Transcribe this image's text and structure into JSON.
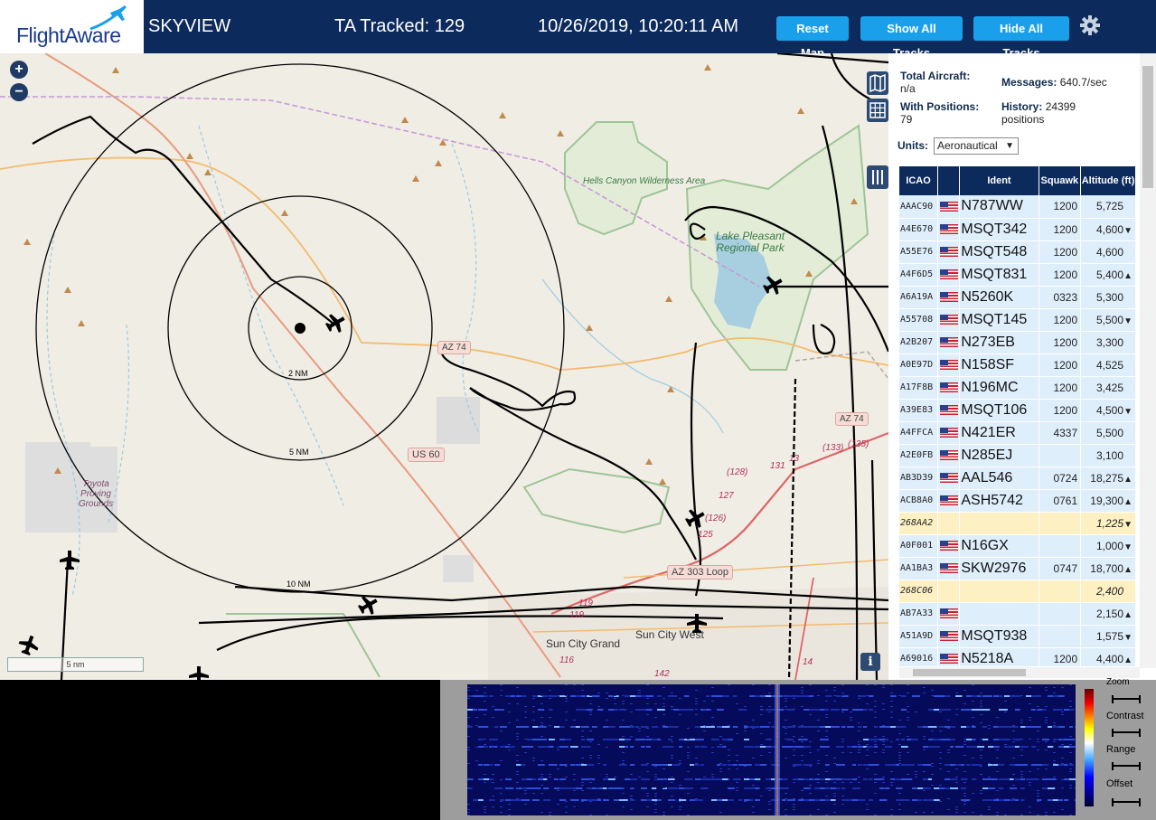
{
  "header": {
    "logo_text": "FlightAware",
    "site_name": "SKYVIEW",
    "tracked": "TA Tracked: 129",
    "clock": "10/26/2019, 10:20:11 AM",
    "buttons": {
      "reset": "Reset Map",
      "show_all": "Show All Tracks",
      "hide_all": "Hide All Tracks"
    },
    "settings_icon": "gear-icon"
  },
  "map": {
    "zoom_in": "+",
    "zoom_out": "−",
    "labels": {
      "hells_canyon": "Hells Canyon Wilderness Area",
      "lake_pleasant": "Lake Pleasant Regional Park",
      "toyota": "Toyota Proving Grounds",
      "sun_city_grand": "Sun City Grand",
      "sun_city_west": "Sun City West"
    },
    "range_rings": [
      "2 NM",
      "5 NM",
      "10 NM"
    ],
    "roads": {
      "az74_a": "AZ 74",
      "az74_b": "AZ 74",
      "us60": "US 60",
      "az303": "AZ 303 Loop",
      "r128": "(128)",
      "r127": "127",
      "r126": "(126)",
      "r125": "125",
      "r131": "131",
      "r13": "13",
      "r133": "(133)",
      "r135": "(135)",
      "r119": "119",
      "r119b": "119",
      "r116": "116",
      "r142": "142",
      "r14": "14"
    },
    "scale": "5 nm",
    "info": "i"
  },
  "panel": {
    "total_aircraft_label": "Total Aircraft:",
    "total_aircraft_value": "n/a",
    "messages_label": "Messages:",
    "messages_value": "640.7/sec",
    "with_positions_label": "With Positions:",
    "with_positions_value": "79",
    "history_label": "History:",
    "history_value": "24399 positions",
    "units_label": "Units:",
    "units_value": "Aeronautical",
    "columns": [
      "ICAO",
      "",
      "Ident",
      "Squawk",
      "Altitude (ft)"
    ],
    "rows": [
      {
        "icao": "AAAC90",
        "flag": true,
        "ident": "N787WW",
        "squawk": "1200",
        "alt": "5,725",
        "trend": "",
        "yellow": false
      },
      {
        "icao": "A4E670",
        "flag": true,
        "ident": "MSQT342",
        "squawk": "1200",
        "alt": "4,600",
        "trend": "▼",
        "yellow": false
      },
      {
        "icao": "A55E76",
        "flag": true,
        "ident": "MSQT548",
        "squawk": "1200",
        "alt": "4,600",
        "trend": "",
        "yellow": false
      },
      {
        "icao": "A4F6D5",
        "flag": true,
        "ident": "MSQT831",
        "squawk": "1200",
        "alt": "5,400",
        "trend": "▲",
        "yellow": false
      },
      {
        "icao": "A6A19A",
        "flag": true,
        "ident": "N5260K",
        "squawk": "0323",
        "alt": "5,300",
        "trend": "",
        "yellow": false
      },
      {
        "icao": "A55708",
        "flag": true,
        "ident": "MSQT145",
        "squawk": "1200",
        "alt": "5,500",
        "trend": "▼",
        "yellow": false
      },
      {
        "icao": "A2B207",
        "flag": true,
        "ident": "N273EB",
        "squawk": "1200",
        "alt": "3,300",
        "trend": "",
        "yellow": false
      },
      {
        "icao": "A0E97D",
        "flag": true,
        "ident": "N158SF",
        "squawk": "1200",
        "alt": "4,525",
        "trend": "",
        "yellow": false
      },
      {
        "icao": "A17F8B",
        "flag": true,
        "ident": "N196MC",
        "squawk": "1200",
        "alt": "3,425",
        "trend": "",
        "yellow": false
      },
      {
        "icao": "A39E83",
        "flag": true,
        "ident": "MSQT106",
        "squawk": "1200",
        "alt": "4,500",
        "trend": "▼",
        "yellow": false
      },
      {
        "icao": "A4FFCA",
        "flag": true,
        "ident": "N421ER",
        "squawk": "4337",
        "alt": "5,500",
        "trend": "",
        "yellow": false
      },
      {
        "icao": "A2E0FB",
        "flag": true,
        "ident": "N285EJ",
        "squawk": "",
        "alt": "3,100",
        "trend": "",
        "yellow": false
      },
      {
        "icao": "AB3D39",
        "flag": true,
        "ident": "AAL546",
        "squawk": "0724",
        "alt": "18,275",
        "trend": "▲",
        "yellow": false
      },
      {
        "icao": "ACB8A0",
        "flag": true,
        "ident": "ASH5742",
        "squawk": "0761",
        "alt": "19,300",
        "trend": "▲",
        "yellow": false
      },
      {
        "icao": "268AA2",
        "flag": false,
        "ident": "",
        "squawk": "",
        "alt": "1,225",
        "trend": "▼",
        "yellow": true
      },
      {
        "icao": "A0F001",
        "flag": true,
        "ident": "N16GX",
        "squawk": "",
        "alt": "1,000",
        "trend": "▼",
        "yellow": false
      },
      {
        "icao": "AA1BA3",
        "flag": true,
        "ident": "SKW2976",
        "squawk": "0747",
        "alt": "18,700",
        "trend": "▲",
        "yellow": false
      },
      {
        "icao": "268C06",
        "flag": false,
        "ident": "",
        "squawk": "",
        "alt": "2,400",
        "trend": "",
        "yellow": true
      },
      {
        "icao": "AB7A33",
        "flag": true,
        "ident": "",
        "squawk": "",
        "alt": "2,150",
        "trend": "▲",
        "yellow": false
      },
      {
        "icao": "A51A9D",
        "flag": true,
        "ident": "MSQT938",
        "squawk": "",
        "alt": "1,575",
        "trend": "▼",
        "yellow": false
      },
      {
        "icao": "A69016",
        "flag": true,
        "ident": "N5218A",
        "squawk": "1200",
        "alt": "4,400",
        "trend": "▲",
        "yellow": false
      }
    ]
  },
  "waterfall": {
    "controls": [
      "Zoom",
      "Contrast",
      "Range",
      "Offset"
    ]
  }
}
